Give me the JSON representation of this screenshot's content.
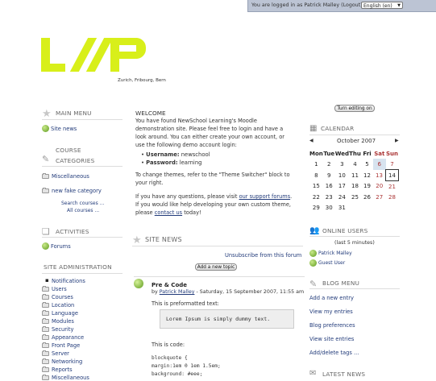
{
  "header": {
    "login_text": "You are logged in as",
    "user": "Patrick Malley",
    "logout": "(Logout)",
    "language": "English (en)",
    "tagline": "Zurich, Fribourg, Bern"
  },
  "logo_label": "LOOP",
  "left": {
    "main_menu_title": "MAIN MENU",
    "site_news": "Site news",
    "course_cat_title_1": "COURSE",
    "course_cat_title_2": "CATEGORIES",
    "cats": [
      "Miscellaneous",
      "new fake category"
    ],
    "search_courses": "Search courses ...",
    "all_courses": "All courses ...",
    "activities_title": "ACTIVITIES",
    "forums": "Forums",
    "admin_title": "SITE ADMINISTRATION",
    "admin_items": [
      "Notifications",
      "Users",
      "Courses",
      "Location",
      "Language",
      "Modules",
      "Security",
      "Appearance",
      "Front Page",
      "Server",
      "Networking",
      "Reports",
      "Miscellaneous"
    ]
  },
  "center": {
    "turn_editing": "Turn editing on",
    "welcome_title": "WELCOME",
    "intro": [
      "You have found NewSchool Learning's Moodle",
      "demonstration site. Please feel free to login and have a",
      "look around. You can either create your own account, or",
      "use the following demo account login:"
    ],
    "username_label": "Username:",
    "username_value": "newschool",
    "password_label": "Password:",
    "password_value": "learning",
    "themes": [
      "To change themes, refer to the \"Theme Switcher\" block to",
      "your right."
    ],
    "questions_pre": "If you have any questions, please visit",
    "support_link": "our support forums",
    "questions_line2": "If you would like help developing your own custom theme,",
    "please": "please",
    "contact_link": "contact us",
    "today": "today!",
    "site_news_title": "SITE NEWS",
    "unsubscribe": "Unsubscribe from this forum",
    "add_topic": "Add a new topic",
    "post_title": "Pre & Code",
    "post_by": "by",
    "post_author": "Patrick Malley",
    "post_date": "- Saturday, 15 September 2007, 11:55 am",
    "pre_intro": "This is preformatted text:",
    "pre_text": "Lorem Ipsum is simply dummy text.",
    "code_intro": "This is code:",
    "code_lines": [
      "blockquote {",
      "margin:1em 0 1em 1.5em;",
      "background: #eee;"
    ]
  },
  "right": {
    "calendar_title": "CALENDAR",
    "month": "October 2007",
    "prev": "◀",
    "next": "▶",
    "days": [
      "Mon",
      "Tue",
      "Wed",
      "Thu",
      "Fri",
      "Sat",
      "Sun"
    ],
    "weeks": [
      [
        "1",
        "2",
        "3",
        "4",
        "5",
        "6",
        "7"
      ],
      [
        "8",
        "9",
        "10",
        "11",
        "12",
        "13",
        "14"
      ],
      [
        "15",
        "16",
        "17",
        "18",
        "19",
        "20",
        "21"
      ],
      [
        "22",
        "23",
        "24",
        "25",
        "26",
        "27",
        "28"
      ],
      [
        "29",
        "30",
        "31",
        "",
        "",
        "",
        ""
      ]
    ],
    "online_title": "ONLINE USERS",
    "online_sub": "(last 5 minutes)",
    "online_users": [
      "Patrick Malley",
      "Guest User"
    ],
    "blog_title": "BLOG MENU",
    "blog_items": [
      "Add a new entry",
      "View my entries",
      "Blog preferences",
      "View site entries",
      "Add/delete tags ..."
    ],
    "latest_title": "LATEST NEWS"
  }
}
